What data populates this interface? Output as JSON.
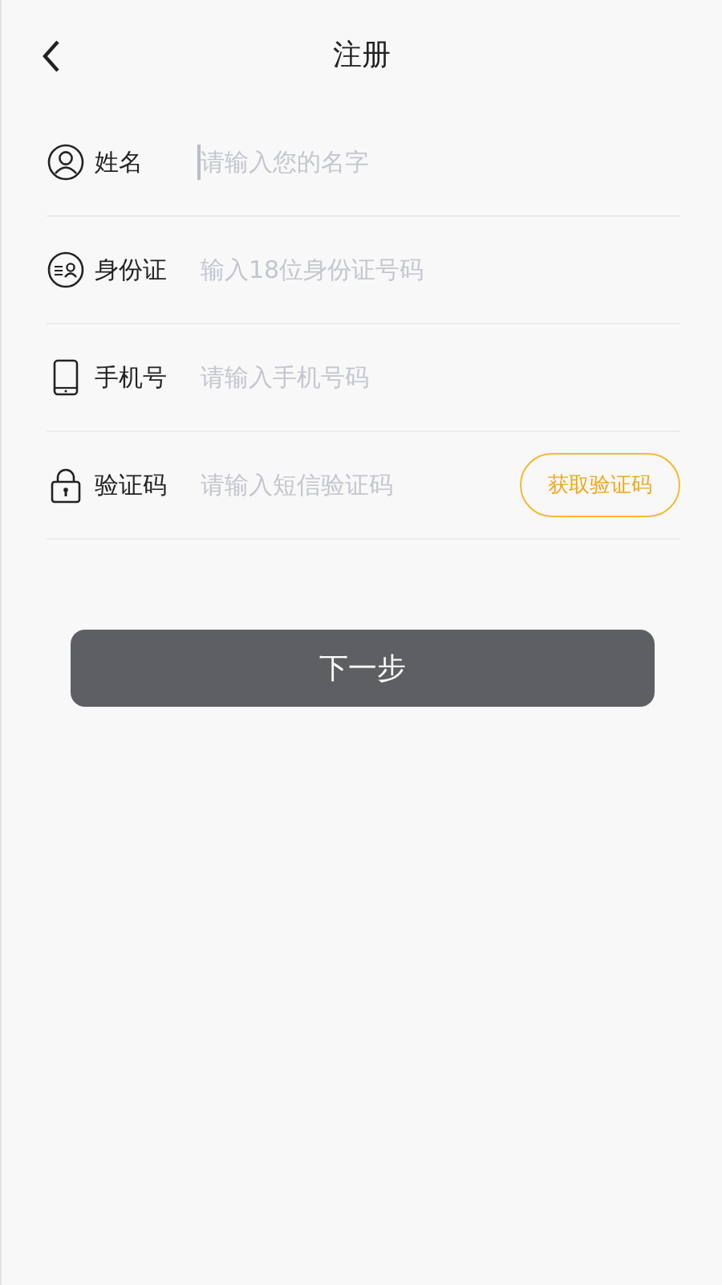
{
  "header": {
    "title": "注册"
  },
  "fields": [
    {
      "kind": "person",
      "label": "姓名",
      "placeholder": "请输入您的名字",
      "focused": true
    },
    {
      "kind": "idcard",
      "label": "身份证",
      "placeholder": "输入18位身份证号码",
      "focused": false
    },
    {
      "kind": "phone",
      "label": "手机号",
      "placeholder": "请输入手机号码",
      "focused": false
    },
    {
      "kind": "lock",
      "label": "验证码",
      "placeholder": "请输入短信验证码",
      "focused": false,
      "action": "获取验证码"
    }
  ],
  "submit": "下一步"
}
